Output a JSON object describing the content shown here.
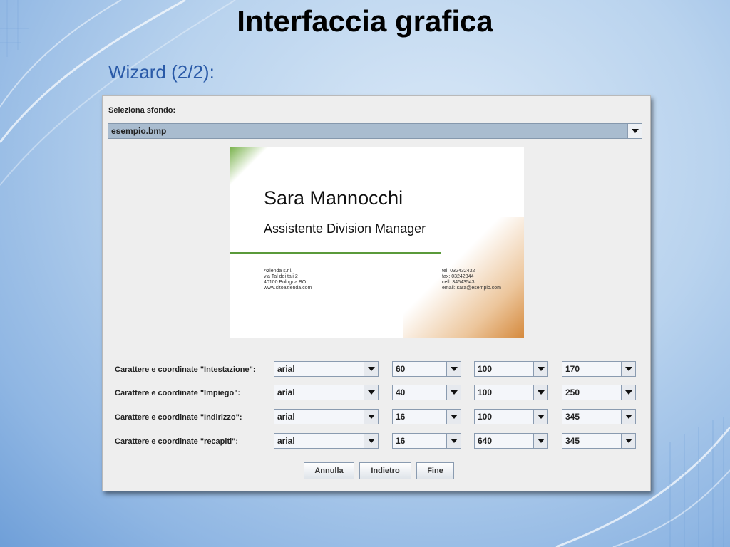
{
  "slide": {
    "title": "Interfaccia grafica",
    "subtitle": "Wizard (2/2):"
  },
  "dialog": {
    "background_label": "Seleziona sfondo:",
    "background_value": "esempio.bmp",
    "card": {
      "name": "Sara Mannocchi",
      "role": "Assistente Division Manager",
      "address_lines": [
        "Azienda s.r.l.",
        "via Tal dei tali 2",
        "40100 Bologna BO",
        "www.sitoazienda.com"
      ],
      "contact_lines": [
        "tel: 032432432",
        "fax: 03242344",
        "cell: 34543543",
        "email: sara@esempio.com"
      ]
    },
    "rows": [
      {
        "label": "Carattere e coordinate \"Intestazione\":",
        "font": "arial",
        "size": "60",
        "x": "100",
        "y": "170"
      },
      {
        "label": "Carattere e coordinate \"Impiego\":",
        "font": "arial",
        "size": "40",
        "x": "100",
        "y": "250"
      },
      {
        "label": "Carattere e coordinate \"Indirizzo\":",
        "font": "arial",
        "size": "16",
        "x": "100",
        "y": "345"
      },
      {
        "label": "Carattere e coordinate \"recapiti\":",
        "font": "arial",
        "size": "16",
        "x": "640",
        "y": "345"
      }
    ],
    "buttons": {
      "cancel": "Annulla",
      "back": "Indietro",
      "finish": "Fine"
    }
  },
  "colors": {
    "title_blue": "#2a5aa8",
    "card_green": "#5a9a3a",
    "card_orange": "#d58a3e"
  }
}
